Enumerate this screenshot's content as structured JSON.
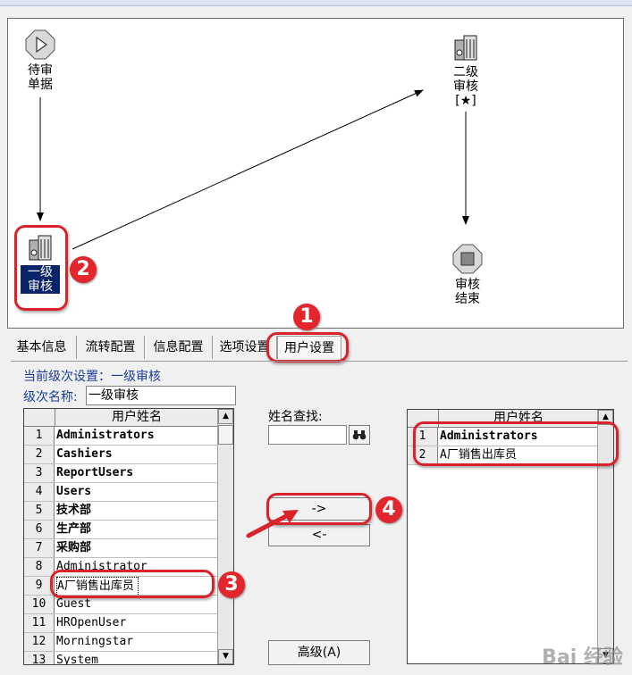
{
  "flow": {
    "nodes": [
      {
        "id": "pending",
        "label": "待审\n单据",
        "icon": "play-circle-icon"
      },
      {
        "id": "level1",
        "label": "一级\n审核",
        "icon": "building-icon",
        "selected": true
      },
      {
        "id": "level2",
        "label": "二级\n审核\n[★]",
        "icon": "building-icon"
      },
      {
        "id": "end",
        "label": "审核\n结束",
        "icon": "stop-circle-icon"
      }
    ]
  },
  "callouts": [
    "1",
    "2",
    "3",
    "4"
  ],
  "tabs": [
    "基本信息",
    "流转配置",
    "信息配置",
    "选项设置",
    "用户设置"
  ],
  "active_tab": "用户设置",
  "settings": {
    "current_level_label": "当前级次设置：一级审核",
    "level_name_label": "级次名称:",
    "level_name_value": "一级审核"
  },
  "left_grid": {
    "header": "用户姓名",
    "rows": [
      {
        "no": "1",
        "name": "Administrators",
        "bold": true
      },
      {
        "no": "2",
        "name": "Cashiers",
        "bold": true
      },
      {
        "no": "3",
        "name": "ReportUsers",
        "bold": true
      },
      {
        "no": "4",
        "name": "Users",
        "bold": true
      },
      {
        "no": "5",
        "name": "技术部",
        "bold": true
      },
      {
        "no": "6",
        "name": "生产部",
        "bold": true
      },
      {
        "no": "7",
        "name": "采购部",
        "bold": true
      },
      {
        "no": "8",
        "name": "Administrator",
        "bold": false
      },
      {
        "no": "9",
        "name": "A厂销售出库员",
        "bold": false
      },
      {
        "no": "10",
        "name": "Guest",
        "bold": false
      },
      {
        "no": "11",
        "name": "HROpenUser",
        "bold": false
      },
      {
        "no": "12",
        "name": "Morningstar",
        "bold": false
      },
      {
        "no": "13",
        "name": "System",
        "bold": false
      }
    ]
  },
  "search": {
    "label": "姓名查找:",
    "value": "",
    "icon": "binoculars-icon"
  },
  "buttons": {
    "add": "->",
    "remove": "<-",
    "advanced": "高级(A)"
  },
  "right_grid": {
    "header": "用户姓名",
    "rows": [
      {
        "no": "1",
        "name": "Administrators",
        "bold": true
      },
      {
        "no": "2",
        "name": "A厂销售出库员",
        "bold": false
      }
    ]
  },
  "watermark": "Bai 经验",
  "colors": {
    "accent_red": "#e3262d",
    "selection_blue": "#0a246a",
    "label_blue": "#1a3d99"
  }
}
